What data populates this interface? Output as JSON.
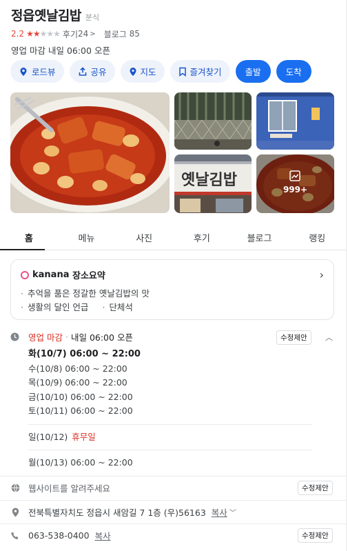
{
  "place": {
    "name": "정읍옛날김밥",
    "category": "분식",
    "rating": "2.2",
    "stars_filled": 2,
    "stars_total": 5,
    "review_label": "후기",
    "review_count": "24",
    "blog_label": "블로그",
    "blog_count": "85",
    "status": "영업 마감",
    "next_open": "내일 06:00 오픈"
  },
  "actions": {
    "roadview": "로드뷰",
    "share": "공유",
    "map": "지도",
    "favorite": "즐겨찾기",
    "depart": "출발",
    "arrive": "도착"
  },
  "photos": {
    "more_count": "999+",
    "sign_text": "옛날김밥"
  },
  "tabs": [
    "홈",
    "메뉴",
    "사진",
    "후기",
    "블로그",
    "랭킹"
  ],
  "summary": {
    "brand": "kanana",
    "title": "장소요약",
    "bullet1": "추억을 품은 정갈한 옛날김밥의 맛",
    "bullet2": "생활의 달인 언급",
    "bullet3": "단체석"
  },
  "hours": {
    "status": "영업 마감",
    "next_open": "내일 06:00 오픈",
    "edit_label": "수정제안",
    "today": "화(10/7)  06:00 ~ 22:00",
    "days": [
      "수(10/8)  06:00 ~ 22:00",
      "목(10/9)  06:00 ~ 22:00",
      "금(10/10)  06:00 ~ 22:00",
      "토(10/11)  06:00 ~ 22:00"
    ],
    "holiday_day": "일(10/12)",
    "holiday_label": "휴무일",
    "monday": "월(10/13)  06:00 ~ 22:00"
  },
  "website": {
    "placeholder": "웹사이트를 알려주세요",
    "edit_label": "수정제안"
  },
  "address": {
    "text": "전북특별자치도 정읍시 새암길 7 1층 (우)56163",
    "copy": "복사"
  },
  "phone": {
    "number": "063-538-0400",
    "copy": "복사",
    "edit_label": "수정제안"
  },
  "colors": {
    "accent_blue": "#1a6ff0",
    "rating_red": "#e8453c",
    "closed_red": "#d93025",
    "pill_bg": "#eef2fb"
  }
}
